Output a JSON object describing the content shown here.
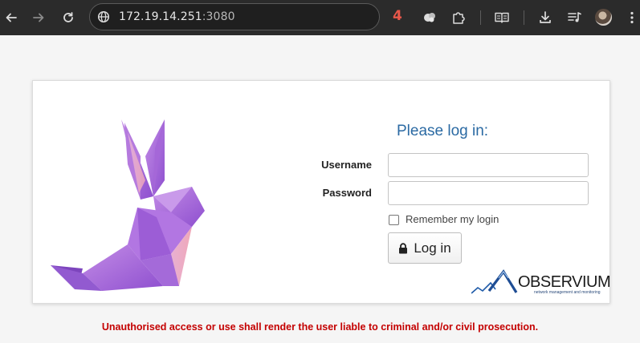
{
  "browser": {
    "url_host": "172.19.14.251",
    "url_port": ":3080",
    "extension_badge": "4",
    "icons": [
      "back-icon",
      "forward-icon",
      "reload-icon",
      "site-info-icon",
      "extension-icon",
      "puzzle-icon",
      "reading-mode-icon",
      "download-icon",
      "media-queue-icon",
      "profile-avatar",
      "menu-icon"
    ],
    "colors": {
      "toolbar": "#2b2b2b",
      "badge": "#e8574a"
    }
  },
  "login": {
    "heading": "Please log in:",
    "username_label": "Username",
    "username_value": "",
    "password_label": "Password",
    "password_value": "",
    "remember_label": "Remember my login",
    "remember_checked": false,
    "submit_label": "Log in",
    "colors": {
      "heading": "#2b6aa3"
    }
  },
  "branding": {
    "logo_word": "OBSERVIUM",
    "logo_tagline": "network management and monitoring"
  },
  "footer": {
    "warning": "Unauthorised access or use shall render the user liable to criminal and/or civil prosecution.",
    "warning_color": "#c40000"
  }
}
